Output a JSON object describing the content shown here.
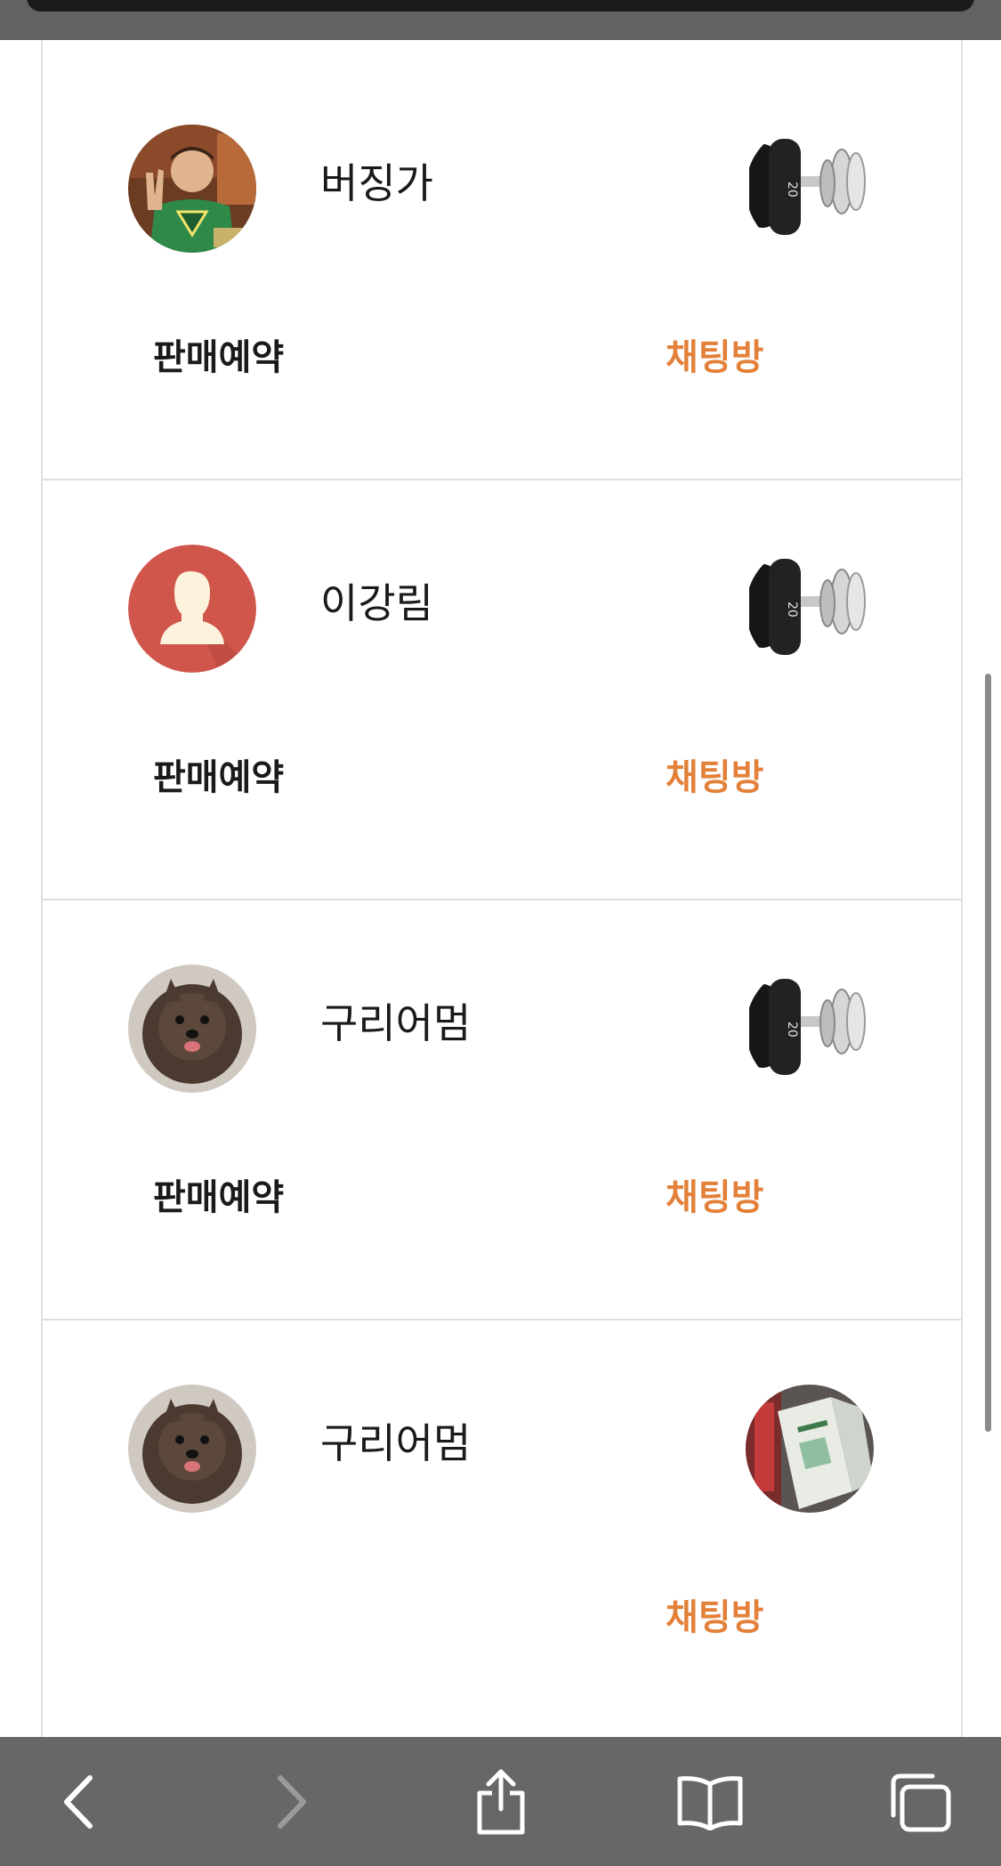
{
  "cards": [
    {
      "nickname": "버징가",
      "status": "판매예약",
      "chat_label": "채팅방",
      "avatar": "sheldon-photo",
      "product": "dumbbell-photo"
    },
    {
      "nickname": "이강림",
      "status": "판매예약",
      "chat_label": "채팅방",
      "avatar": "default-user-avatar",
      "product": "dumbbell-photo"
    },
    {
      "nickname": "구리어멈",
      "status": "판매예약",
      "chat_label": "채팅방",
      "avatar": "pomeranian-photo",
      "product": "dumbbell-photo"
    },
    {
      "nickname": "구리어멈",
      "status": "",
      "chat_label": "채팅방",
      "avatar": "pomeranian-photo",
      "product": "cosmetics-box-photo"
    }
  ],
  "colors": {
    "accent": "#e3813a",
    "toolbar": "#676767",
    "text": "#1a1a1a"
  },
  "toolbar": {
    "icons": [
      "back-arrow-icon",
      "forward-arrow-icon",
      "share-icon",
      "bookmarks-icon",
      "tabs-icon"
    ]
  }
}
